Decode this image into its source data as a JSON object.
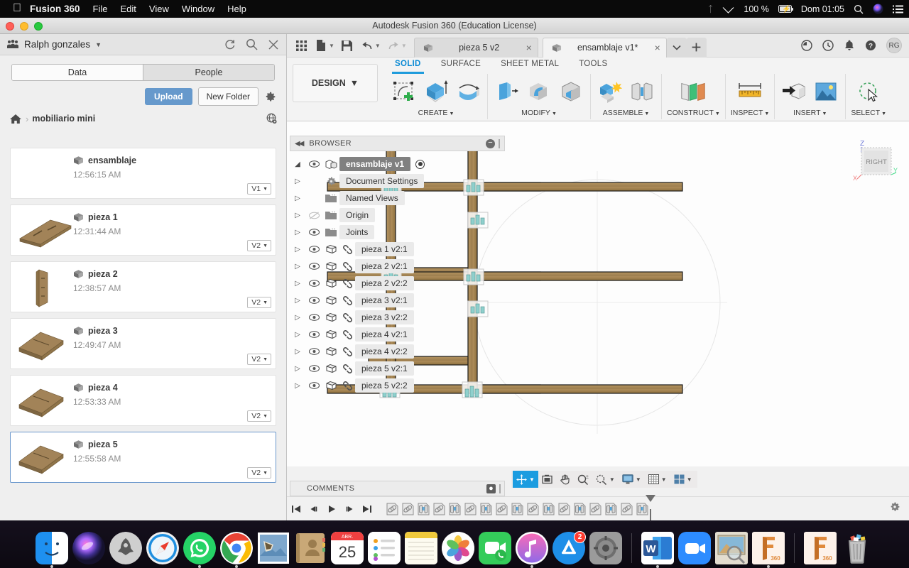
{
  "macbar": {
    "apple_icon": "apple-icon",
    "app_name": "Fusion 360",
    "menus": [
      "File",
      "Edit",
      "View",
      "Window",
      "Help"
    ],
    "bluetooth_icon": "bluetooth-icon",
    "wifi_icon": "wifi-icon",
    "battery_percent": "100 %",
    "battery_icon": "battery-charging-icon",
    "clock": "Dom 01:05",
    "search_icon": "spotlight-search-icon",
    "siri_icon": "siri-icon",
    "控制": "control-center-icon",
    "notification_icon": "notification-center-icon"
  },
  "window": {
    "title": "Autodesk Fusion 360 (Education License)",
    "close_label": "close",
    "minimize_label": "minimize",
    "zoom_label": "zoom"
  },
  "data_panel": {
    "user_name": "Ralph gonzales",
    "people_icon": "people-icon",
    "dropdown_icon": "chevron-down-icon",
    "refresh_icon": "refresh-icon",
    "search_icon": "search-icon",
    "close_icon": "close-icon",
    "tabs": [
      {
        "label": "Data",
        "active": true
      },
      {
        "label": "People",
        "active": false
      }
    ],
    "upload_label": "Upload",
    "new_folder_label": "New Folder",
    "settings_icon": "gear-icon",
    "home_icon": "home-icon",
    "breadcrumb_sep": "›",
    "folder_name": "mobiliario mini",
    "globe_icon": "globe-web-icon",
    "files": [
      {
        "name": "ensamblaje",
        "time": "12:56:15 AM",
        "version": "V1",
        "selected": false,
        "thumb": "none"
      },
      {
        "name": "pieza 1",
        "time": "12:31:44 AM",
        "version": "V2",
        "selected": false,
        "thumb": "plank-long"
      },
      {
        "name": "pieza 2",
        "time": "12:38:57 AM",
        "version": "V2",
        "selected": false,
        "thumb": "plank-vertical"
      },
      {
        "name": "pieza 3",
        "time": "12:49:47 AM",
        "version": "V2",
        "selected": false,
        "thumb": "plank-square"
      },
      {
        "name": "pieza 4",
        "time": "12:53:33 AM",
        "version": "V2",
        "selected": false,
        "thumb": "plank-square"
      },
      {
        "name": "pieza 5",
        "time": "12:55:58 AM",
        "version": "V2",
        "selected": true,
        "thumb": "plank-square"
      }
    ]
  },
  "fusion": {
    "quickbar": {
      "grid_icon": "app-grid-icon",
      "new_icon": "new-document-icon",
      "save_icon": "save-icon",
      "undo_icon": "undo-icon",
      "redo_icon": "redo-icon",
      "profile_initials": "RG",
      "job_icon": "job-status-icon",
      "history_icon": "history-icon",
      "bell_icon": "notification-bell-icon",
      "help_icon": "help-icon",
      "add_tab_icon": "plus-icon",
      "tab_overflow_icon": "chevron-down-icon"
    },
    "document_tabs": [
      {
        "label": "pieza 5 v2",
        "active": false,
        "close_icon": "close-icon"
      },
      {
        "label": "ensamblaje v1*",
        "active": true,
        "close_icon": "close-icon"
      }
    ],
    "workspace": {
      "label": "DESIGN",
      "caret": "▾"
    },
    "ribbon_tabs": [
      {
        "label": "SOLID",
        "active": true
      },
      {
        "label": "SURFACE",
        "active": false
      },
      {
        "label": "SHEET METAL",
        "active": false
      },
      {
        "label": "TOOLS",
        "active": false
      }
    ],
    "ribbon_groups": [
      {
        "label": "CREATE",
        "caret": "▾",
        "icons": [
          "sketch-create-icon",
          "extrude-icon",
          "revolve-icon"
        ]
      },
      {
        "label": "MODIFY",
        "caret": "▾",
        "icons": [
          "press-pull-icon",
          "fillet-icon",
          "shell-icon"
        ]
      },
      {
        "label": "ASSEMBLE",
        "caret": "▾",
        "icons": [
          "new-component-icon",
          "joint-icon"
        ]
      },
      {
        "label": "CONSTRUCT",
        "caret": "▾",
        "icons": [
          "offset-plane-icon"
        ]
      },
      {
        "label": "INSPECT",
        "caret": "▾",
        "icons": [
          "measure-icon"
        ]
      },
      {
        "label": "INSERT",
        "caret": "▾",
        "icons": [
          "insert-derive-icon",
          "insert-canvas-icon"
        ]
      },
      {
        "label": "SELECT",
        "caret": "▾",
        "icons": [
          "select-lasso-icon"
        ]
      }
    ],
    "browser": {
      "title": "BROWSER",
      "collapse_icon": "collapse-left-icon",
      "minimize_icon": "minimize-icon",
      "root": {
        "label": "ensamblaje v1",
        "arrow": "expanded",
        "eye_icon": "eye-visible-icon",
        "component_icon": "assembly-icon",
        "radio_icon": "activate-radio-icon"
      },
      "nodes": [
        {
          "label": "Document Settings",
          "icon": "gear-icon",
          "eye": "none",
          "link": false
        },
        {
          "label": "Named Views",
          "icon": "folder-icon",
          "eye": "none",
          "link": false
        },
        {
          "label": "Origin",
          "icon": "folder-icon",
          "eye": "hidden",
          "link": false
        },
        {
          "label": "Joints",
          "icon": "folder-icon",
          "eye": "visible",
          "link": false
        },
        {
          "label": "pieza 1 v2:1",
          "icon": "body-icon",
          "eye": "visible",
          "link": true
        },
        {
          "label": "pieza 2 v2:1",
          "icon": "body-icon",
          "eye": "visible",
          "link": true
        },
        {
          "label": "pieza 2 v2:2",
          "icon": "body-icon",
          "eye": "visible",
          "link": true
        },
        {
          "label": "pieza 3 v2:1",
          "icon": "body-icon",
          "eye": "visible",
          "link": true
        },
        {
          "label": "pieza 3 v2:2",
          "icon": "body-icon",
          "eye": "visible",
          "link": true
        },
        {
          "label": "pieza 4 v2:1",
          "icon": "body-icon",
          "eye": "visible",
          "link": true
        },
        {
          "label": "pieza 4 v2:2",
          "icon": "body-icon",
          "eye": "visible",
          "link": true
        },
        {
          "label": "pieza 5 v2:1",
          "icon": "body-icon",
          "eye": "visible",
          "link": true
        },
        {
          "label": "pieza 5 v2:2",
          "icon": "body-icon",
          "eye": "visible",
          "link": true
        }
      ]
    },
    "viewcube": {
      "face_label": "RIGHT",
      "axis_z": "Z",
      "axis_y": "Y",
      "axis_x": "X"
    },
    "comments": {
      "title": "COMMENTS",
      "add_icon": "add-comment-icon"
    },
    "navbar": [
      {
        "icon": "orbit-icon",
        "active": true,
        "caret": "▾"
      },
      {
        "icon": "look-at-icon",
        "active": false,
        "caret": ""
      },
      {
        "icon": "pan-icon",
        "active": false,
        "caret": ""
      },
      {
        "icon": "zoom-icon",
        "active": false,
        "caret": ""
      },
      {
        "icon": "zoom-window-icon",
        "active": false,
        "caret": "▾"
      },
      {
        "icon": "display-settings-icon",
        "active": false,
        "caret": "▾"
      },
      {
        "icon": "grid-snap-icon",
        "active": false,
        "caret": "▾"
      },
      {
        "icon": "viewports-icon",
        "active": false,
        "caret": "▾"
      }
    ],
    "timeline": {
      "controls": [
        "go-to-beginning-icon",
        "step-back-icon",
        "play-icon",
        "step-forward-icon",
        "go-to-end-icon"
      ],
      "features": [
        "joint-feature-icon",
        "joint-feature-icon",
        "rigid-joint-icon",
        "joint-feature-icon",
        "rigid-joint-icon",
        "joint-feature-icon",
        "rigid-joint-icon",
        "joint-feature-icon",
        "rigid-joint-icon",
        "joint-feature-icon",
        "rigid-joint-icon",
        "joint-feature-icon",
        "rigid-joint-icon",
        "joint-feature-icon",
        "rigid-joint-icon",
        "joint-feature-icon",
        "rigid-joint-icon"
      ],
      "settings_icon": "gear-icon"
    },
    "colors": {
      "accent_blue": "#1e9bdc",
      "upload_blue": "#6699cc",
      "selection_blue": "#6a97cc",
      "joint_teal": "#8fd0cd",
      "wood": "#a08155"
    }
  },
  "dock": {
    "items": [
      {
        "name": "finder",
        "running": true
      },
      {
        "name": "siri",
        "running": false
      },
      {
        "name": "launchpad",
        "running": false
      },
      {
        "name": "safari",
        "running": false
      },
      {
        "name": "whatsapp",
        "running": false
      },
      {
        "name": "chrome",
        "running": true
      },
      {
        "name": "mail",
        "running": false
      },
      {
        "name": "contacts",
        "running": false
      },
      {
        "name": "calendar",
        "running": false,
        "month": "ABR.",
        "day": "25"
      },
      {
        "name": "reminders",
        "running": false
      },
      {
        "name": "notes",
        "running": false
      },
      {
        "name": "photos",
        "running": false
      },
      {
        "name": "facetime",
        "running": false
      },
      {
        "name": "itunes",
        "running": true
      },
      {
        "name": "app-store",
        "running": false,
        "badge": "2"
      },
      {
        "name": "system-preferences",
        "running": false
      },
      {
        "name": "word",
        "running": true
      },
      {
        "name": "zoom",
        "running": false
      },
      {
        "name": "preview",
        "running": false
      },
      {
        "name": "fusion-360",
        "running": true
      },
      {
        "name": "fusion-360-alt",
        "running": false
      },
      {
        "name": "trash",
        "running": false
      }
    ]
  }
}
